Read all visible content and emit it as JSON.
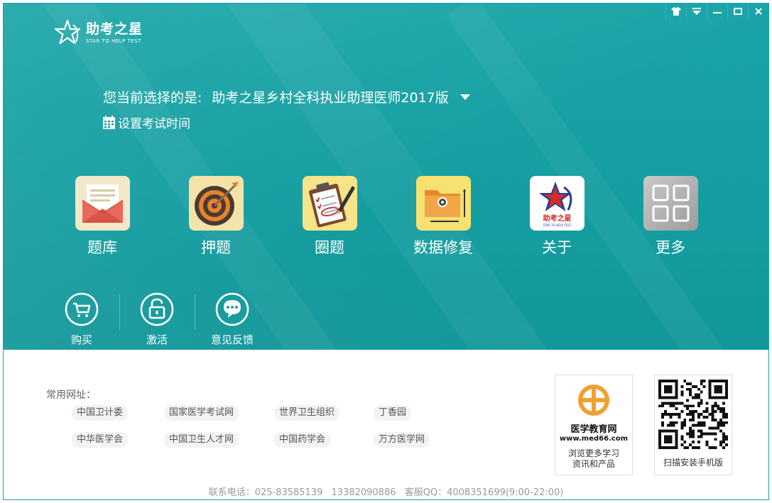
{
  "window": {
    "controls": [
      "skin-icon",
      "menu-icon",
      "minimize-icon",
      "maximize-icon",
      "close-icon"
    ]
  },
  "logo": {
    "name": "助考之星",
    "slogan": "STAR TO HELP TEST"
  },
  "selection": {
    "prefix": "您当前选择的是:",
    "product": "助考之星乡村全科执业助理医师2017版",
    "set_exam_time": "设置考试时间"
  },
  "modules": [
    {
      "label": "题库",
      "icon": "envelope-icon"
    },
    {
      "label": "押题",
      "icon": "target-icon"
    },
    {
      "label": "圈题",
      "icon": "clipboard-icon"
    },
    {
      "label": "数据修复",
      "icon": "folder-gear-icon"
    },
    {
      "label": "关于",
      "icon": "star-logo-icon"
    },
    {
      "label": "更多",
      "icon": "grid-icon"
    }
  ],
  "about_icon_text": {
    "cn": "助考之星",
    "en": "STAR TO HELP TEST"
  },
  "actions": [
    {
      "label": "购买",
      "icon": "cart-icon"
    },
    {
      "label": "激活",
      "icon": "unlock-icon"
    },
    {
      "label": "意见反馈",
      "icon": "chat-icon"
    }
  ],
  "links": {
    "title": "常用网址：",
    "row1": [
      "中国卫计委",
      "国家医学考试网",
      "世界卫生组织",
      "丁香园"
    ],
    "row2": [
      "中华医学会",
      "中国卫生人才网",
      "中国药学会",
      "万方医学网"
    ]
  },
  "promo": {
    "site_name": "医学教育网",
    "site_url": "www.med66.com",
    "site_caption_1": "浏览更多学习",
    "site_caption_2": "资讯和产品",
    "qr_caption": "扫描安装手机版"
  },
  "footer": {
    "phone": "联系电话：025-83585139",
    "mobile": "13382090886",
    "qq": "客服QQ：4008351699(9:00-22:00)"
  },
  "colors": {
    "teal": "#16a0a3",
    "accent_orange": "#e8832a"
  }
}
